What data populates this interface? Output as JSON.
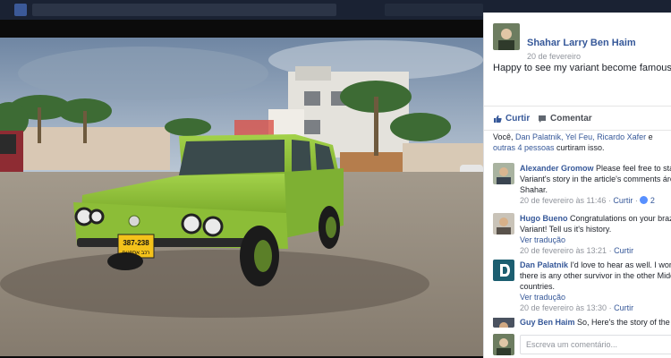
{
  "post": {
    "author": "Shahar Larry Ben Haim",
    "date": "20 de fevereiro",
    "text": "Happy to see my variant become famous"
  },
  "actions": {
    "like": "Curtir",
    "comment": "Comentar"
  },
  "likes_summary": {
    "prefix": "Você, ",
    "names": "Dan Palatnik, Yel Feu, Ricardo Xafer",
    "conj": " e",
    "others": "outras 4 pessoas",
    "suffix": " curtiram isso."
  },
  "comments": [
    {
      "author": "Alexander Gromow",
      "text": "Please feel free to sta",
      "text2": "Variant's story in the article's comments áre",
      "text3": "Shahar.",
      "time": "20 de fevereiro às 11:46",
      "like": "Curtir",
      "reactions": "2"
    },
    {
      "author": "Hugo Bueno",
      "text": "Congratulations on your braz",
      "text2": "Variant! Tell us it's history.",
      "translate": "Ver tradução",
      "time": "20 de fevereiro às 13:21",
      "like": "Curtir"
    },
    {
      "author": "Dan Palatnik",
      "text": "I'd love to hear as well. I wor",
      "text2": "there is any other survivor in the other Midd",
      "text3": "countries.",
      "translate": "Ver tradução",
      "time": "20 de fevereiro às 13:30",
      "like": "Curtir"
    },
    {
      "author": "Guy Ben Haim",
      "text": "So, Here's the story of the"
    }
  ],
  "composer": {
    "placeholder": "Escreva um comentário..."
  },
  "plate": {
    "number": "387-238",
    "sub": "רכב אספנות"
  },
  "colors": {
    "link": "#365899",
    "car": "#8fc43a",
    "panel_bg": "#ffffff",
    "photo_bg": "#0b0b0b"
  }
}
